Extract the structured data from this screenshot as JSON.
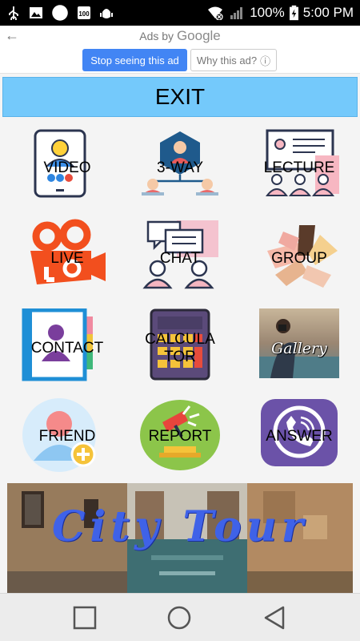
{
  "status": {
    "battery": "100%",
    "time": "5:00 PM"
  },
  "ads": {
    "header": "Ads by",
    "brand": "Google",
    "stop_label": "Stop seeing this ad",
    "why_label": "Why this ad?",
    "info_glyph": "ⓘ",
    "back_glyph": "←"
  },
  "exit": {
    "label": "EXIT"
  },
  "tiles": [
    {
      "label": "VIDEO",
      "icon": "video-call-icon"
    },
    {
      "label": "3-WAY",
      "icon": "three-way-icon"
    },
    {
      "label": "LECTURE",
      "icon": "lecture-icon"
    },
    {
      "label": "LIVE",
      "icon": "live-camera-icon"
    },
    {
      "label": "CHAT",
      "icon": "chat-icon"
    },
    {
      "label": "GROUP",
      "icon": "group-hands-icon"
    },
    {
      "label": "CONTACT",
      "icon": "contact-book-icon"
    },
    {
      "label": "CALCULA TOR",
      "icon": "calculator-icon"
    },
    {
      "label": "Gallery",
      "icon": "gallery-photo-icon"
    },
    {
      "label": "FRIEND",
      "icon": "add-friend-icon"
    },
    {
      "label": "REPORT",
      "icon": "report-gavel-icon"
    },
    {
      "label": "ANSWER",
      "icon": "viber-phone-icon"
    }
  ],
  "banner": {
    "title": "City Tour"
  },
  "colors": {
    "exit_bg": "#74c9fb",
    "ad_button": "#4285f4",
    "banner_text": "#3f62e8"
  }
}
